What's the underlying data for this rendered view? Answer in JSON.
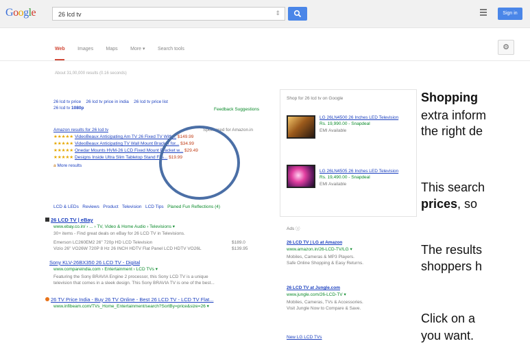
{
  "header": {
    "logo": [
      "G",
      "o",
      "o",
      "g",
      "l",
      "e"
    ],
    "query": "26 lcd tv",
    "signin_label": "Sign in"
  },
  "tabs": [
    "Web",
    "Images",
    "Maps",
    "More ▾",
    "Search tools"
  ],
  "stats": "About 31,00,000 results (0.16 seconds)",
  "related": {
    "row1": [
      "26 lcd tv price",
      "26 lcd tv price in india",
      "26 lcd tv price list"
    ],
    "row2_prefix": "26 lcd tv",
    "row2_bold": "1080p",
    "feedback": "Feedback Suggestions"
  },
  "amazon": {
    "header": "Amazon results for 26 lcd tv",
    "sponsored": "Sponsored for Amazon.in",
    "items": [
      {
        "stars": "★★★★★",
        "text": "VideoBeaux Anticipating Am TV 26 Fixed TV With...",
        "price": "$149.99"
      },
      {
        "stars": "★★★★★",
        "text": "VideoBeaux Anticipating TV Wall Mount Bracket for...",
        "price": "$34.99"
      },
      {
        "stars": "★★★★★",
        "text": "Onedar Mounts HVM-26 LCD Fixed Mount Bracket w...",
        "price": "$29.49"
      },
      {
        "stars": "★★★★★",
        "text": "Designs Inside Ultra Slim Tabletop Stand Fits...",
        "price": "$19.99"
      }
    ],
    "more": "More results"
  },
  "ad_links": [
    "LCD & LEDs",
    "Reviews",
    "Product",
    "Television",
    "LCD Tips",
    "Planed Fun Reflections (4)"
  ],
  "results": [
    {
      "title": "26 LCD TV | eBay",
      "url": "www.ebay.co.in/ › ... › TV, Video & Home Audio › Televisions ▾",
      "snippet": "30+ items - Find great deals on eBay for 26 LCD TV in Televisions.",
      "rows": [
        [
          "Emerson LC260EM2 26\" 720p HD LCD Television",
          "$189.00"
        ],
        [
          "Vizio 26\" VO26W 720P 8 Hz 26 INCH HDTV Flat Panel LCD HDTV VO26L",
          "$139.95"
        ]
      ]
    },
    {
      "title": "Sony KLV-26BX350 26 LCD TV - Digital",
      "url": "www.compareindia.com › Entertainment › LCD TVs ▾",
      "snippet1": "Featuring the Sony BRAVIA Engine 2 processor, this Sony LCD TV is a unique",
      "snippet2": "television that comes in a sleek design. This Sony BRAVIA TV is one of the best..."
    },
    {
      "title": "26 TV Price India - Buy 26 TV Online - Best 26 LCD TV - LCD TV Flat...",
      "url": "www.infibeam.com/TVs_Home_Entertainment/search?SortBy=price&size=26 ▾"
    }
  ],
  "shopping": {
    "title": "Shop for 26 lcd tv on Google",
    "items": [
      {
        "name": "LG 26LN4500 26 Inches LED Television",
        "price": "Rs. 19,990.00 - Snapdeal",
        "extra": "EMI Available"
      },
      {
        "name": "LG 26LN4505 26 Inches LED Television",
        "price": "Rs. 19,490.00 - Snapdeal",
        "extra": "EMI Available"
      }
    ]
  },
  "right_ads": {
    "label": "Ads ⓘ",
    "ads": [
      {
        "title": "26 LCD TV | LG at Amazon",
        "url": "www.amazon.in/26-LCD-TV/LG ▾",
        "l1": "Mobiles, Cameras & MP3 Players.",
        "l2": "Safe Online Shopping & Easy Returns."
      },
      {
        "title": "26 LCD TV at Jungle.com",
        "url": "www.jungle.com/26-LCD-TV ▾",
        "l1": "Mobiles, Cameras, TVs & Accessories.",
        "l2": "Visit Jungle Now to Compare & Save."
      },
      {
        "title": "New LG LCD TVs",
        "url": ""
      }
    ]
  },
  "overlay": {
    "l1_bold": "Shopping",
    "l2": "extra inform",
    "l3": "the right de",
    "l4": "This search",
    "l5_bold": "prices",
    "l5_rest": ", so",
    "l6": "The results",
    "l7": "shoppers h",
    "l8": "Click on a",
    "l9": "you want."
  }
}
